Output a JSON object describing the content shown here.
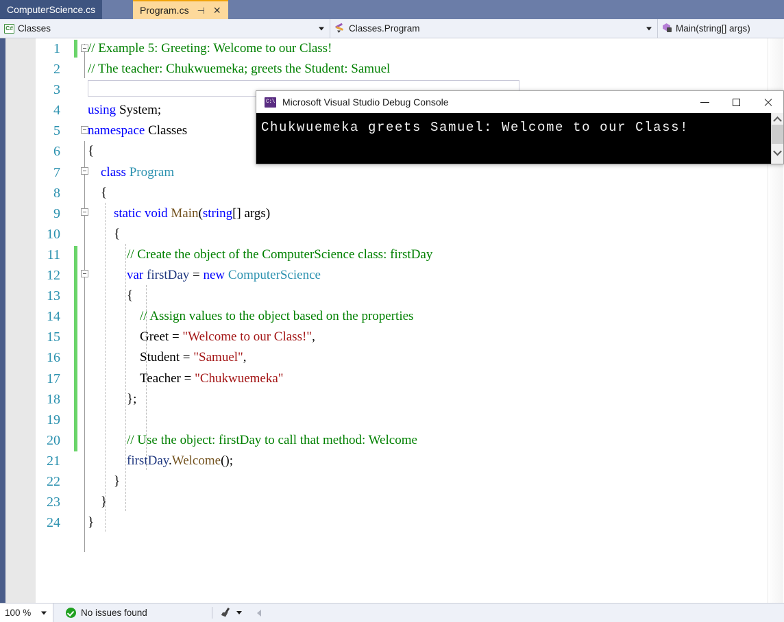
{
  "tabs": [
    {
      "label": "ComputerScience.cs",
      "active": false
    },
    {
      "label": "Program.cs",
      "active": true,
      "pin_icon": "pin-icon",
      "close_icon": "close-icon"
    }
  ],
  "navbar": {
    "project": {
      "icon": "csharp-file-icon",
      "text": "Classes"
    },
    "type": {
      "icon": "class-method-icon",
      "text": "Classes.Program"
    },
    "member": {
      "icon": "method-private-icon",
      "text": "Main(string[] args)"
    }
  },
  "editor": {
    "lines": [
      {
        "num": "1",
        "indent": 0,
        "tokens": [
          {
            "t": "// Example 5: Greeting: Welcome to our Class!",
            "c": "c-com"
          }
        ]
      },
      {
        "num": "2",
        "indent": 0,
        "tokens": [
          {
            "t": "// The teacher: Chukwuemeka; greets the Student: Samuel",
            "c": "c-com"
          }
        ]
      },
      {
        "num": "3",
        "indent": 0,
        "tokens": []
      },
      {
        "num": "4",
        "indent": 0,
        "tokens": [
          {
            "t": "using",
            "c": "c-kw"
          },
          {
            "t": " ",
            "c": "c-plain"
          },
          {
            "t": "System",
            "c": "c-plain"
          },
          {
            "t": ";",
            "c": "c-plain"
          }
        ]
      },
      {
        "num": "5",
        "indent": 0,
        "tokens": [
          {
            "t": "namespace",
            "c": "c-kw"
          },
          {
            "t": " Classes",
            "c": "c-plain"
          }
        ]
      },
      {
        "num": "6",
        "indent": 0,
        "tokens": [
          {
            "t": "{",
            "c": "c-plain"
          }
        ]
      },
      {
        "num": "7",
        "indent": 1,
        "tokens": [
          {
            "t": "class",
            "c": "c-kw"
          },
          {
            "t": " ",
            "c": "c-plain"
          },
          {
            "t": "Program",
            "c": "c-type"
          }
        ]
      },
      {
        "num": "8",
        "indent": 1,
        "tokens": [
          {
            "t": "{",
            "c": "c-plain"
          }
        ]
      },
      {
        "num": "9",
        "indent": 2,
        "tokens": [
          {
            "t": "static",
            "c": "c-kw"
          },
          {
            "t": " ",
            "c": "c-plain"
          },
          {
            "t": "void",
            "c": "c-kw"
          },
          {
            "t": " ",
            "c": "c-plain"
          },
          {
            "t": "Main",
            "c": "c-meth"
          },
          {
            "t": "(",
            "c": "c-plain"
          },
          {
            "t": "string",
            "c": "c-kw"
          },
          {
            "t": "[] args)",
            "c": "c-plain"
          }
        ]
      },
      {
        "num": "10",
        "indent": 2,
        "tokens": [
          {
            "t": "{",
            "c": "c-plain"
          }
        ]
      },
      {
        "num": "11",
        "indent": 3,
        "tokens": [
          {
            "t": "// Create the object of the ComputerScience class: firstDay",
            "c": "c-com"
          }
        ]
      },
      {
        "num": "12",
        "indent": 3,
        "tokens": [
          {
            "t": "var",
            "c": "c-kw"
          },
          {
            "t": " ",
            "c": "c-plain"
          },
          {
            "t": "firstDay",
            "c": "c-local"
          },
          {
            "t": " = ",
            "c": "c-plain"
          },
          {
            "t": "new",
            "c": "c-kw"
          },
          {
            "t": " ",
            "c": "c-plain"
          },
          {
            "t": "ComputerScience",
            "c": "c-type"
          }
        ]
      },
      {
        "num": "13",
        "indent": 3,
        "tokens": [
          {
            "t": "{",
            "c": "c-plain"
          }
        ]
      },
      {
        "num": "14",
        "indent": 4,
        "tokens": [
          {
            "t": "// Assign values to the object based on the properties",
            "c": "c-com"
          }
        ]
      },
      {
        "num": "15",
        "indent": 4,
        "tokens": [
          {
            "t": "Greet = ",
            "c": "c-plain"
          },
          {
            "t": "\"Welcome to our Class!\"",
            "c": "c-str"
          },
          {
            "t": ",",
            "c": "c-plain"
          }
        ]
      },
      {
        "num": "16",
        "indent": 4,
        "tokens": [
          {
            "t": "Student = ",
            "c": "c-plain"
          },
          {
            "t": "\"Samuel\"",
            "c": "c-str"
          },
          {
            "t": ",",
            "c": "c-plain"
          }
        ]
      },
      {
        "num": "17",
        "indent": 4,
        "tokens": [
          {
            "t": "Teacher = ",
            "c": "c-plain"
          },
          {
            "t": "\"Chukwuemeka\"",
            "c": "c-str"
          }
        ]
      },
      {
        "num": "18",
        "indent": 3,
        "tokens": [
          {
            "t": "};",
            "c": "c-plain"
          }
        ]
      },
      {
        "num": "19",
        "indent": 3,
        "tokens": []
      },
      {
        "num": "20",
        "indent": 3,
        "tokens": [
          {
            "t": "// Use the object: firstDay to call that method: Welcome",
            "c": "c-com"
          }
        ]
      },
      {
        "num": "21",
        "indent": 3,
        "tokens": [
          {
            "t": "firstDay",
            "c": "c-local"
          },
          {
            "t": ".",
            "c": "c-plain"
          },
          {
            "t": "Welcome",
            "c": "c-meth"
          },
          {
            "t": "();",
            "c": "c-plain"
          }
        ]
      },
      {
        "num": "22",
        "indent": 2,
        "tokens": [
          {
            "t": "}",
            "c": "c-plain"
          }
        ]
      },
      {
        "num": "23",
        "indent": 1,
        "tokens": [
          {
            "t": "}",
            "c": "c-plain"
          }
        ]
      },
      {
        "num": "24",
        "indent": 0,
        "tokens": [
          {
            "t": "}",
            "c": "c-plain"
          }
        ]
      }
    ]
  },
  "console": {
    "title": "Microsoft Visual Studio Debug Console",
    "icon": "command-prompt-icon",
    "output": "Chukwuemeka greets Samuel: Welcome to our Class!",
    "minimize_icon": "minimize-icon",
    "maximize_icon": "maximize-icon",
    "close_icon": "close-icon"
  },
  "statusbar": {
    "zoom": "100 %",
    "issues": "No issues found",
    "issues_icon": "check-circle-icon",
    "brush_icon": "brush-icon",
    "back_icon": "left-arrow-icon"
  },
  "colors": {
    "comment": "#008000",
    "keyword": "#0000ff",
    "type": "#2b91af",
    "string": "#a31515",
    "method": "#74531f",
    "local": "#1f377f",
    "changebar": "#6ad46a",
    "active_tab": "#fdd99b",
    "inactive_tab": "#3e5480"
  }
}
